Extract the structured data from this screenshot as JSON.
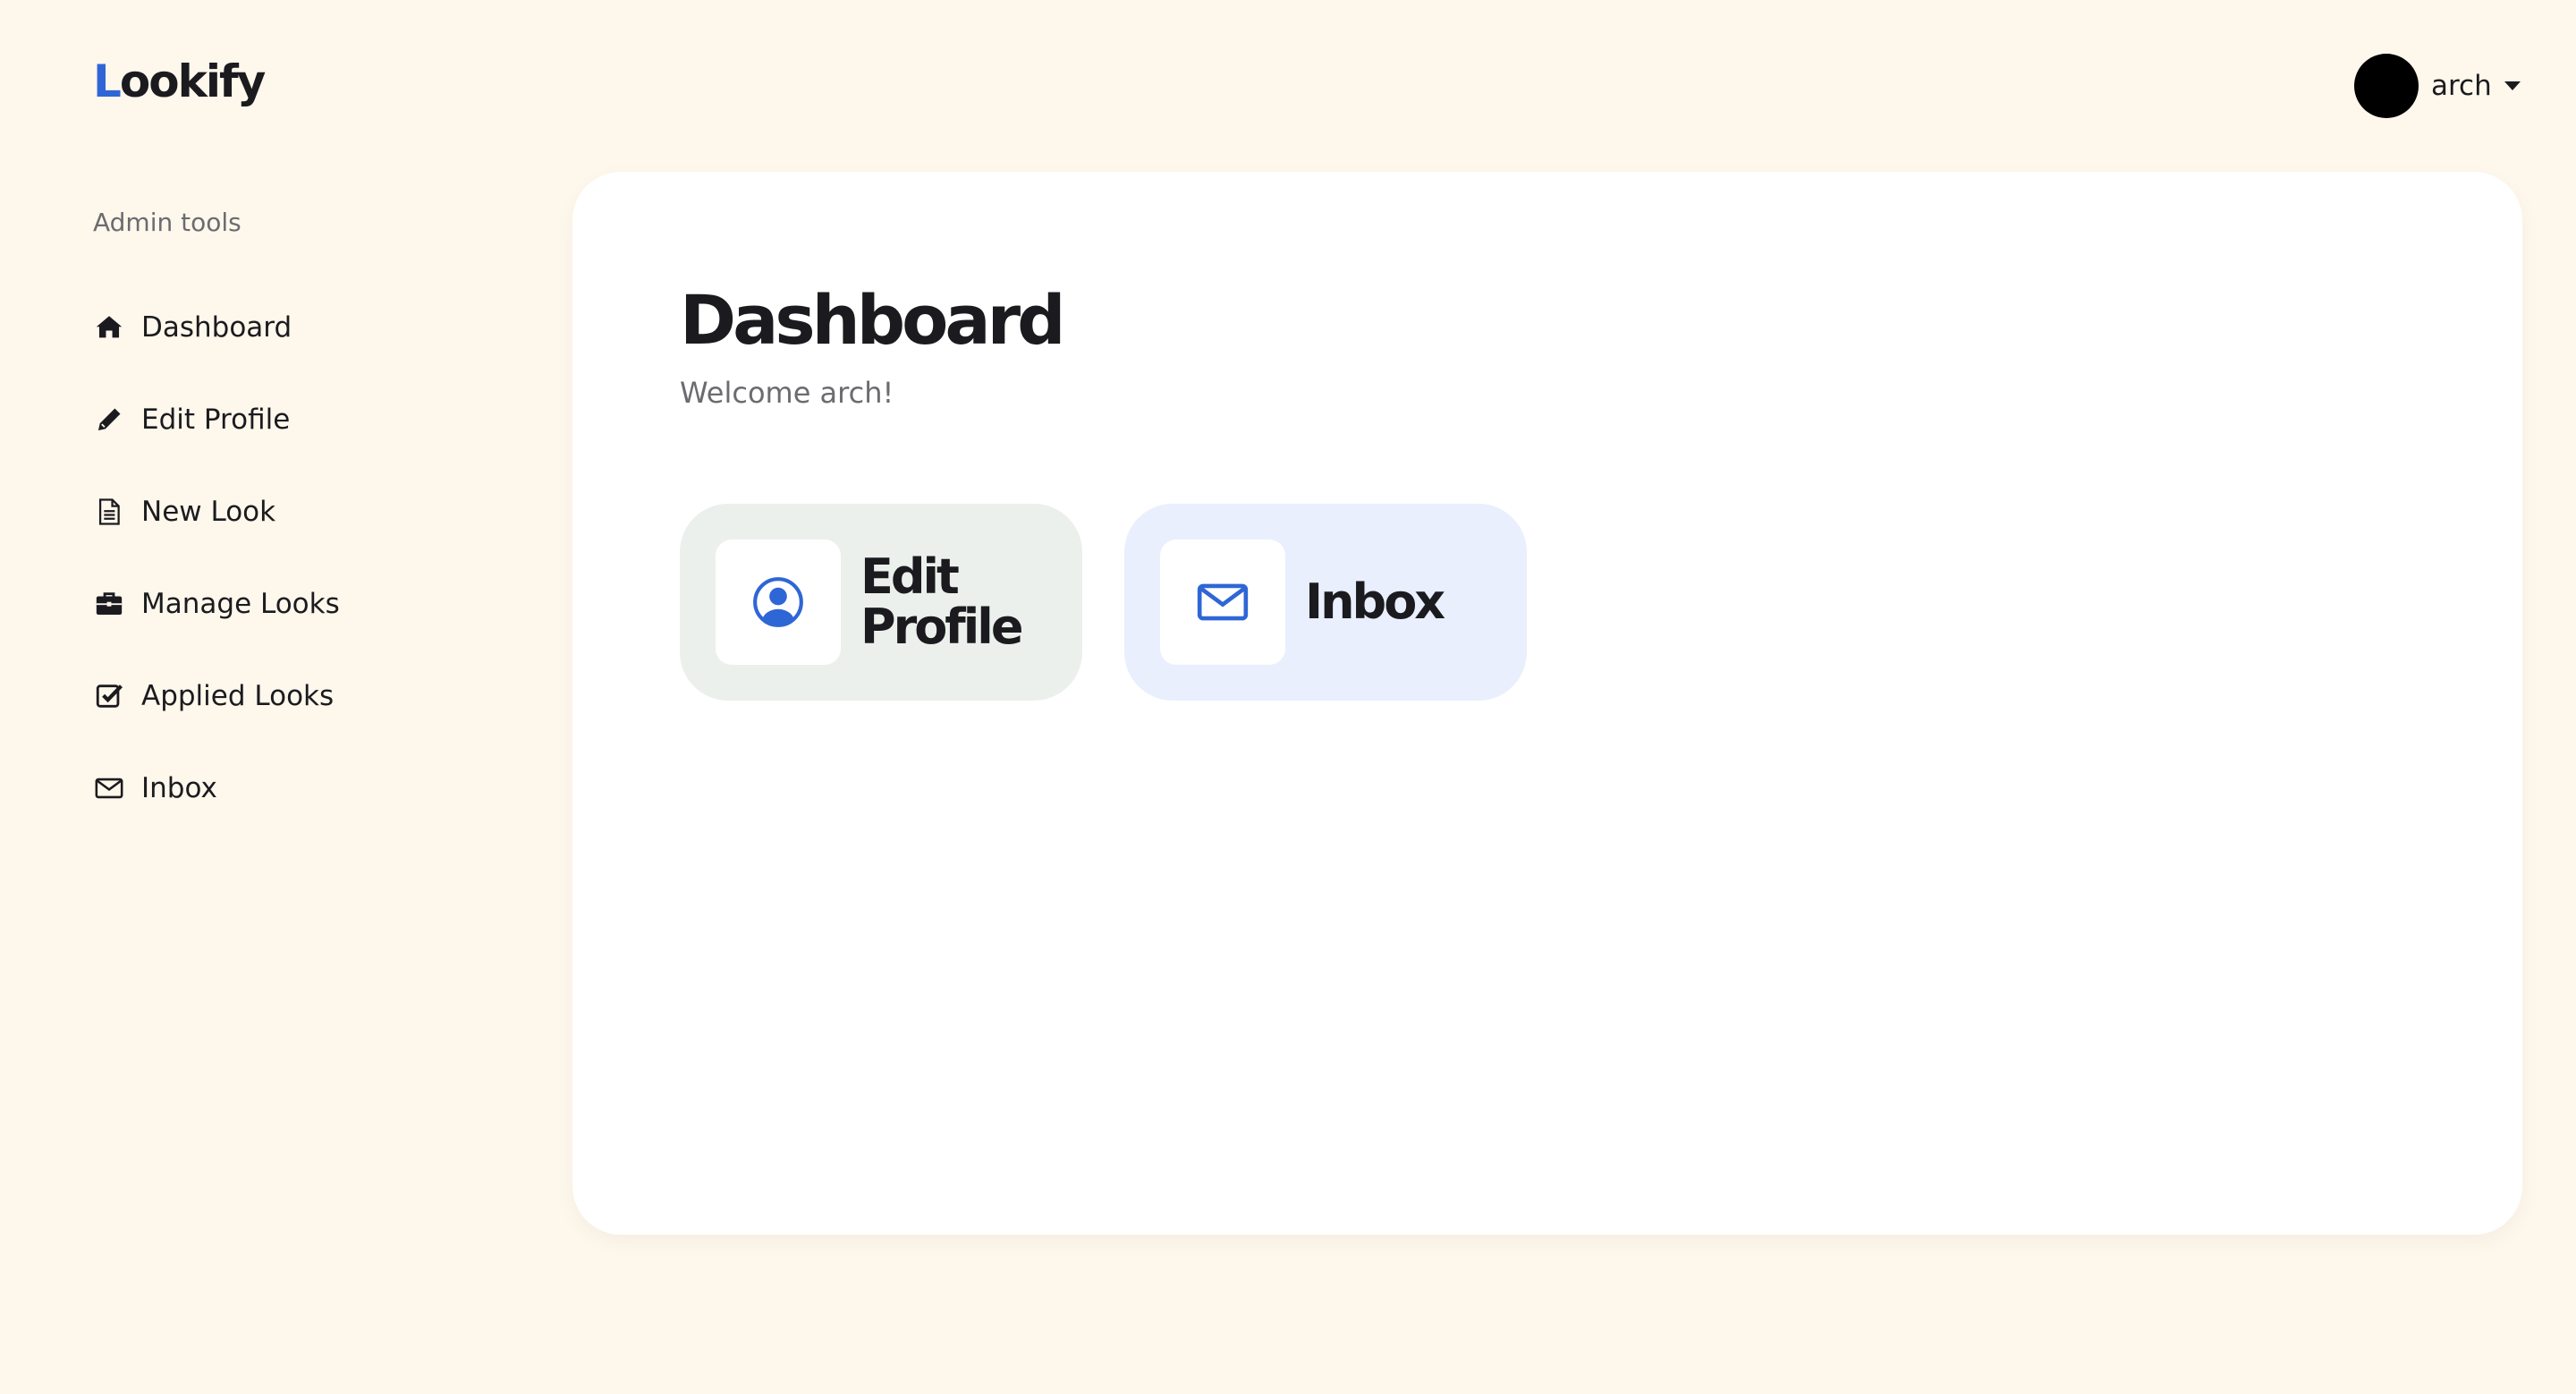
{
  "header": {
    "logo_first": "L",
    "logo_rest": "ookify",
    "user_name": "arch"
  },
  "sidebar": {
    "heading": "Admin tools",
    "items": [
      {
        "label": "Dashboard",
        "icon": "home-icon"
      },
      {
        "label": "Edit Profile",
        "icon": "pencil-icon"
      },
      {
        "label": "New Look",
        "icon": "document-icon"
      },
      {
        "label": "Manage Looks",
        "icon": "briefcase-icon"
      },
      {
        "label": "Applied Looks",
        "icon": "checkbox-icon"
      },
      {
        "label": "Inbox",
        "icon": "envelope-icon"
      }
    ]
  },
  "main": {
    "title": "Dashboard",
    "subtitle": "Welcome arch!",
    "tiles": [
      {
        "label": "Edit Profile",
        "icon": "user-circle-icon",
        "background": "#EBF0EC"
      },
      {
        "label": "Inbox",
        "icon": "envelope-icon",
        "background": "#E9EFFD"
      }
    ]
  },
  "colors": {
    "page_background": "#FEF7EC",
    "accent": "#2F66D6",
    "text": "#1B1B1F",
    "muted_text": "#6B6B70"
  }
}
